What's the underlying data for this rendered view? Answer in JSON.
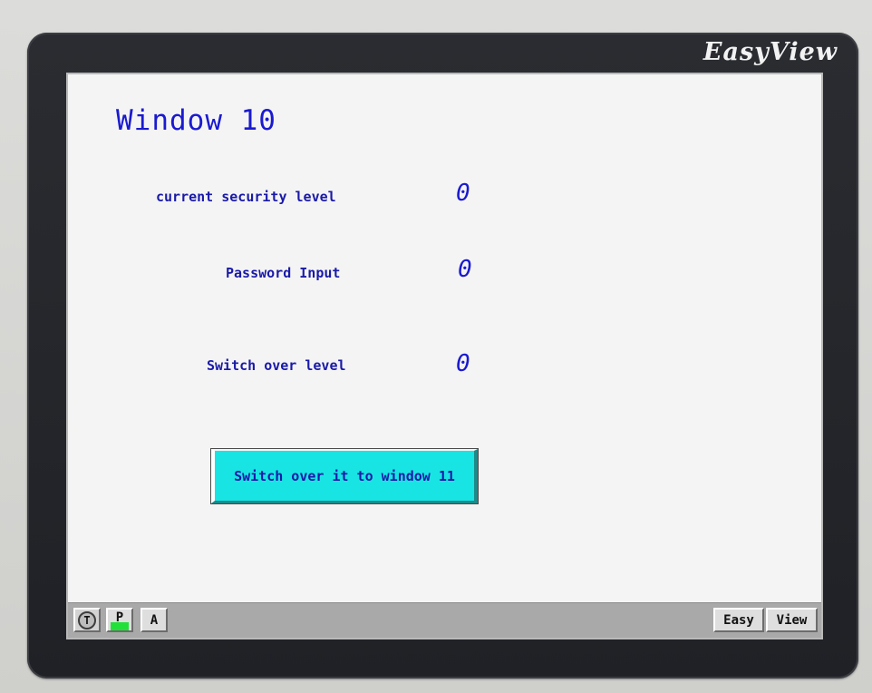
{
  "device": {
    "brand": "EasyView"
  },
  "screen": {
    "title": "Window 10",
    "rows": [
      {
        "label": "current security level",
        "value": "0"
      },
      {
        "label": "Password Input",
        "value": "0"
      },
      {
        "label": "Switch over level",
        "value": "0"
      }
    ],
    "switch_button_label": "Switch over it to window 11"
  },
  "taskbar": {
    "t_label": "T",
    "p_label": "P",
    "a_label": "A",
    "easy_label": "Easy",
    "view_label": "View"
  },
  "colors": {
    "bezel": "#22242a",
    "screen_bg": "#f4f4f4",
    "text_blue": "#1a1ad0",
    "button_cyan": "#19e4e4",
    "led_green": "#22e03a",
    "taskbar_gray": "#a9a9a9"
  }
}
